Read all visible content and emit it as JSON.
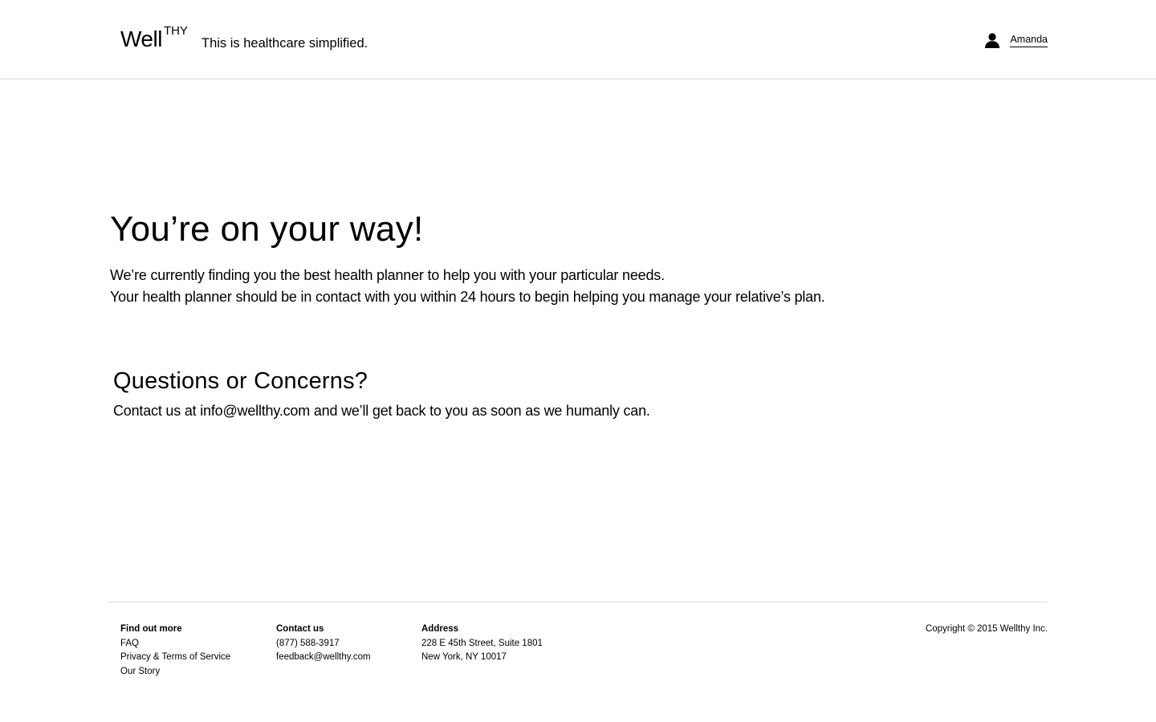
{
  "header": {
    "logo_main": "Well",
    "logo_sup": "THY",
    "tagline": "This is healthcare simplified.",
    "user_icon": "user-icon",
    "user_name": "Amanda"
  },
  "main": {
    "title": "You’re on your way!",
    "line1": "We’re currently finding you the best health planner to help you with your particular needs.",
    "line2": "Your health planner should be in contact with you within 24 hours to begin helping you manage your relative’s plan.",
    "questions_title": "Questions or Concerns?",
    "questions_text": "Contact us at info@wellthy.com and we’ll get back to you as soon as we humanly can."
  },
  "footer": {
    "find_out_more": {
      "heading": "Find out more",
      "items": [
        "FAQ",
        "Privacy & Terms of Service",
        "Our Story"
      ]
    },
    "contact": {
      "heading": "Contact us",
      "items": [
        "(877) 588-3917",
        "feedback@wellthy.com"
      ]
    },
    "address": {
      "heading": "Address",
      "items": [
        "228 E 45th Street, Suite 1801",
        "New York, NY 10017"
      ]
    },
    "copyright": "Copyright © 2015 Wellthy Inc."
  }
}
